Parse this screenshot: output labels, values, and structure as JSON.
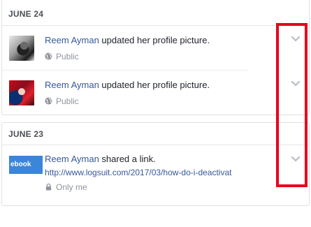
{
  "sections": [
    {
      "title": "JUNE 24",
      "items": [
        {
          "actor": "Reem Ayman",
          "action": " updated her profile picture.",
          "privacy": "Public",
          "privacy_icon": "globe-icon"
        },
        {
          "actor": "Reem Ayman",
          "action": " updated her profile picture.",
          "privacy": "Public",
          "privacy_icon": "globe-icon"
        }
      ]
    },
    {
      "title": "JUNE 23",
      "items": [
        {
          "actor": "Reem Ayman",
          "action": " shared a link.",
          "link": "http://www.logsuit.com/2017/03/how-do-i-deactivat",
          "thumb_text": "ebook",
          "privacy": "Only me",
          "privacy_icon": "lock-icon"
        }
      ]
    }
  ],
  "colors": {
    "actor": "#365899",
    "muted": "#90949c",
    "highlight": "#e8001c"
  }
}
